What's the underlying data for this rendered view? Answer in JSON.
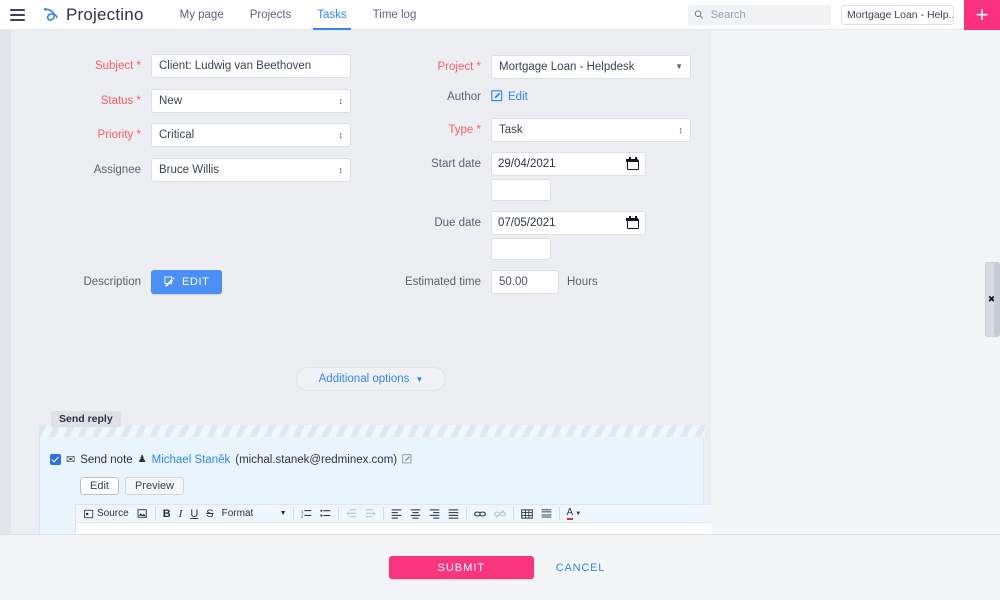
{
  "header": {
    "menu_icon": "hamburger-icon",
    "brand": "Projectino",
    "nav": [
      {
        "label": "My page",
        "active": false
      },
      {
        "label": "Projects",
        "active": false
      },
      {
        "label": "Tasks",
        "active": true
      },
      {
        "label": "Time log",
        "active": false
      }
    ],
    "search": {
      "placeholder": "Search",
      "value": "",
      "icon": "search-icon"
    },
    "project_selector": {
      "value": "Mortgage Loan - Help...",
      "icon": "updown-arrows-icon"
    },
    "add_button": {
      "label": "+",
      "color": "#f9307e"
    }
  },
  "form": {
    "subject": {
      "label": "Subject",
      "required": true,
      "value": "Client: Ludwig van Beethoven"
    },
    "status": {
      "label": "Status",
      "required": true,
      "value": "New"
    },
    "priority": {
      "label": "Priority",
      "required": true,
      "value": "Critical"
    },
    "assignee": {
      "label": "Assignee",
      "required": false,
      "value": "Bruce Willis"
    },
    "project": {
      "label": "Project",
      "required": true,
      "value": "Mortgage Loan - Helpdesk"
    },
    "author": {
      "label": "Author",
      "edit_link": "Edit",
      "icon": "edit-pencil-icon"
    },
    "type": {
      "label": "Type",
      "required": true,
      "value": "Task"
    },
    "start_date": {
      "label": "Start date",
      "value": "29/04/2021",
      "icon": "calendar-icon",
      "sub_value": ""
    },
    "due_date": {
      "label": "Due date",
      "value": "07/05/2021",
      "icon": "calendar-icon",
      "sub_value": ""
    },
    "description": {
      "label": "Description",
      "button_label": "EDIT",
      "icon": "edit-pencil-icon"
    },
    "estimated_time": {
      "label": "Estimated time",
      "value": "50.00",
      "unit": "Hours"
    },
    "additional_options": {
      "label": "Additional options",
      "icon": "chevron-down-icon"
    }
  },
  "reply": {
    "tab_label": "Send reply",
    "send_note": {
      "checked": true,
      "mail_icon": "envelope-icon",
      "label": "Send note",
      "person_icon": "person-icon",
      "name": "Michael Staněk",
      "email": "(michal.stanek@redminex.com)",
      "external_icon": "edit-external-icon"
    },
    "mode_buttons": [
      {
        "label": "Edit",
        "selected": true
      },
      {
        "label": "Preview",
        "selected": false
      }
    ],
    "toolbar": {
      "source_label": "Source",
      "format_label": "Format",
      "items": [
        "source-icon",
        "image-icon",
        "bold-icon",
        "italic-icon",
        "underline-icon",
        "strikethrough-icon",
        "format-dropdown",
        "numbered-list-icon",
        "bulleted-list-icon",
        "outdent-icon",
        "indent-icon",
        "align-left-icon",
        "align-center-icon",
        "align-right-icon",
        "align-justify-icon",
        "link-icon",
        "unlink-icon",
        "table-icon",
        "horizontal-rule-icon",
        "text-color-icon"
      ]
    },
    "editor_value": ""
  },
  "footer": {
    "submit_label": "SUBMIT",
    "cancel_label": "CANCEL",
    "submit_color": "#f9357f",
    "cancel_color": "#2f86f6"
  },
  "side_panel_handle": {
    "icon": "close-icon",
    "label": "✖"
  }
}
